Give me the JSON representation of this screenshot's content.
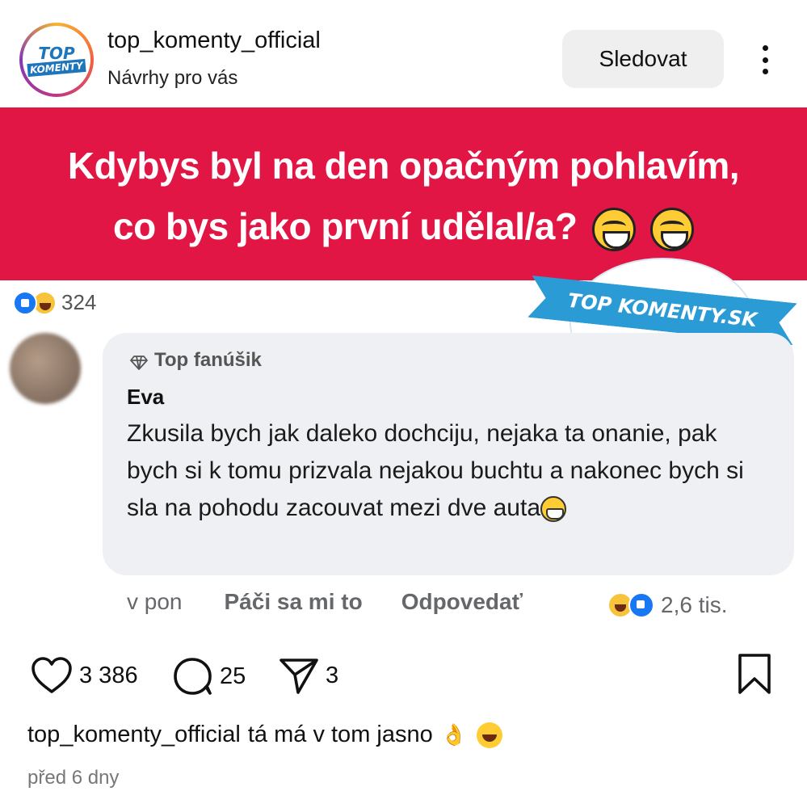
{
  "header": {
    "avatar_logo_top": "TOP",
    "avatar_logo_bottom": "KOMENTY",
    "username": "top_komenty_official",
    "subtitle": "Návrhy pro vás",
    "follow_label": "Sledovat"
  },
  "post": {
    "banner_line1": "Kdybys byl na den opačným pohlavím,",
    "banner_line2": "co bys jako první udělal/a?",
    "reactions_count": "324",
    "watermark": "TOP KOMENTY.SK",
    "comment": {
      "badge": "Top fanúšik",
      "author": "Eva",
      "text": "Zkusila bych jak daleko dochciju, nejaka ta onanie, pak bych si k tomu prizvala nejakou buchtu a nakonec bych si sla na pohodu zacouvat mezi dve auta",
      "time": "v pon",
      "like_label": "Páči sa mi to",
      "reply_label": "Odpovedať",
      "reactions_count": "2,6 tis."
    }
  },
  "actions": {
    "likes": "3 386",
    "comments": "25",
    "shares": "3"
  },
  "caption": {
    "user": "top_komenty_official",
    "text": "tá má v tom jasno",
    "ok_emoji": "👌"
  },
  "date": "před 6 dny",
  "colors": {
    "banner": "#e11645",
    "accent_blue": "#1877f2",
    "watermark_blue": "#2b9bd6"
  },
  "icons": [
    "heart-icon",
    "comment-icon",
    "share-icon",
    "bookmark-icon",
    "more-icon",
    "diamond-icon"
  ]
}
